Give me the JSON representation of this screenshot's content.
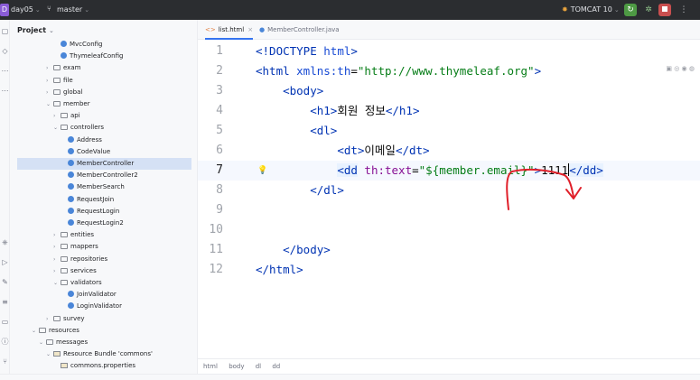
{
  "topbar": {
    "project_badge": "D",
    "project_name": "day05",
    "vcs_branch": "master",
    "run_config": "TOMCAT 10"
  },
  "panel": {
    "title": "Project",
    "tree": [
      {
        "label": "MvcConfig",
        "kind": "class",
        "indent": 5
      },
      {
        "label": "ThymeleafConfig",
        "kind": "class",
        "indent": 5
      },
      {
        "label": "exam",
        "kind": "folder",
        "indent": 4,
        "arrow": "›"
      },
      {
        "label": "file",
        "kind": "folder",
        "indent": 4,
        "arrow": "›"
      },
      {
        "label": "global",
        "kind": "folder",
        "indent": 4,
        "arrow": "›"
      },
      {
        "label": "member",
        "kind": "folder",
        "indent": 4,
        "arrow": "⌄"
      },
      {
        "label": "api",
        "kind": "folder",
        "indent": 5,
        "arrow": "›"
      },
      {
        "label": "controllers",
        "kind": "folder",
        "indent": 5,
        "arrow": "⌄"
      },
      {
        "label": "Address",
        "kind": "class",
        "indent": 6
      },
      {
        "label": "CodeValue",
        "kind": "class",
        "indent": 6
      },
      {
        "label": "MemberController",
        "kind": "class",
        "indent": 6,
        "selected": true
      },
      {
        "label": "MemberController2",
        "kind": "class",
        "indent": 6
      },
      {
        "label": "MemberSearch",
        "kind": "class",
        "indent": 6
      },
      {
        "label": "RequestJoin",
        "kind": "class",
        "indent": 6
      },
      {
        "label": "RequestLogin",
        "kind": "class",
        "indent": 6
      },
      {
        "label": "RequestLogin2",
        "kind": "class",
        "indent": 6
      },
      {
        "label": "entities",
        "kind": "folder",
        "indent": 5,
        "arrow": "›"
      },
      {
        "label": "mappers",
        "kind": "folder",
        "indent": 5,
        "arrow": "›"
      },
      {
        "label": "repositories",
        "kind": "folder",
        "indent": 5,
        "arrow": "›"
      },
      {
        "label": "services",
        "kind": "folder",
        "indent": 5,
        "arrow": "›"
      },
      {
        "label": "validators",
        "kind": "folder",
        "indent": 5,
        "arrow": "⌄"
      },
      {
        "label": "JoinValidator",
        "kind": "class",
        "indent": 6
      },
      {
        "label": "LoginValidator",
        "kind": "class",
        "indent": 6
      },
      {
        "label": "survey",
        "kind": "folder",
        "indent": 4,
        "arrow": "›"
      },
      {
        "label": "resources",
        "kind": "folder",
        "indent": 2,
        "arrow": "⌄"
      },
      {
        "label": "messages",
        "kind": "folder",
        "indent": 3,
        "arrow": "⌄"
      },
      {
        "label": "Resource Bundle 'commons'",
        "kind": "res",
        "indent": 4,
        "arrow": "⌄"
      },
      {
        "label": "commons.properties",
        "kind": "res",
        "indent": 5
      }
    ]
  },
  "tabs": [
    {
      "label": "list.html",
      "icon": "html-file-icon",
      "active": true
    },
    {
      "label": "MemberController.java",
      "icon": "java-class-icon",
      "active": false
    }
  ],
  "editor": {
    "line_numbers": [
      "1",
      "2",
      "3",
      "4",
      "5",
      "6",
      "7",
      "8",
      "9",
      "10",
      "11",
      "12"
    ],
    "current_line": "7",
    "lines": [
      "<!DOCTYPE html>",
      "<html xmlns:th=\"http://www.thymeleaf.org\">",
      "    <body>",
      "        <h1>회원 정보</h1>",
      "        <dl>",
      "            <dt>이메일</dt>",
      "            <dd th:text=\"${member.email}\">1111</dd>",
      "        </dl>",
      "",
      "",
      "    </body>",
      "</html>"
    ],
    "inlay_icons": "browser-preview-icons"
  },
  "breadcrumb": [
    "html",
    "body",
    "dl",
    "dd"
  ]
}
